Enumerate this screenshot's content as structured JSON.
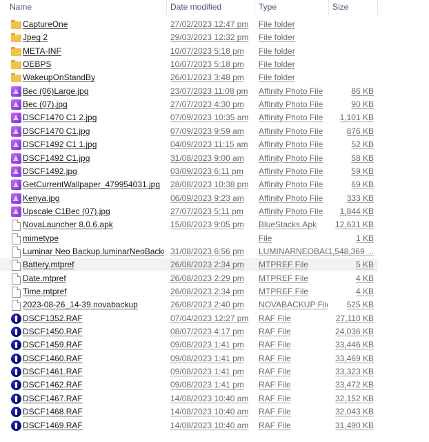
{
  "header": {
    "name": "Name",
    "date": "Date modified",
    "type": "Type",
    "size": "Size"
  },
  "rows": [
    {
      "icon": "folder-icon",
      "name": "CaptureOne",
      "date": "27/02/2023 12:47 pm",
      "type": "File folder",
      "size": ""
    },
    {
      "icon": "folder-icon",
      "name": "Jpeg 2",
      "date": "29/03/2023 12:32 pm",
      "type": "File folder",
      "size": ""
    },
    {
      "icon": "folder-icon",
      "name": "META-INF",
      "date": "10/07/2023 5:18 pm",
      "type": "File folder",
      "size": ""
    },
    {
      "icon": "folder-icon",
      "name": "OEBPS",
      "date": "10/07/2023 5:18 pm",
      "type": "File folder",
      "size": ""
    },
    {
      "icon": "folder-icon",
      "name": "WakeupOnStandBy",
      "date": "26/01/2023 3:48 pm",
      "type": "File folder",
      "size": ""
    },
    {
      "icon": "affinity-photo-icon",
      "name": "Bec (06)Large.jpg",
      "date": "23/07/2023 11:08 pm",
      "type": "Affinity Photo File",
      "size": "86 KB"
    },
    {
      "icon": "affinity-photo-icon",
      "name": "Bec (07).jpg",
      "date": "27/07/2023 4:30 pm",
      "type": "Affinity Photo File",
      "size": "90 KB"
    },
    {
      "icon": "affinity-photo-icon",
      "name": "DSCF1470 C1 2.jpg",
      "date": "07/09/2023 10:35 am",
      "type": "Affinity Photo File",
      "size": "1,101 KB"
    },
    {
      "icon": "affinity-photo-icon",
      "name": "DSCF1470 C1.jpg",
      "date": "07/09/2023 9:59 am",
      "type": "Affinity Photo File",
      "size": "876 KB"
    },
    {
      "icon": "affinity-photo-icon",
      "name": "DSCF1492 C1 1.jpg",
      "date": "04/09/2023 11:15 am",
      "type": "Affinity Photo File",
      "size": "52 KB"
    },
    {
      "icon": "affinity-photo-icon",
      "name": "DSCF1492 C1.jpg",
      "date": "31/08/2023 9:00 am",
      "type": "Affinity Photo File",
      "size": "58 KB"
    },
    {
      "icon": "affinity-photo-icon",
      "name": "DSCF1492.jpg",
      "date": "03/09/2023 6:11 pm",
      "type": "Affinity Photo File",
      "size": "59 KB"
    },
    {
      "icon": "affinity-photo-icon",
      "name": "GetCurrentWallpaper_479954031.jpg",
      "date": "28/08/2023 10:38 pm",
      "type": "Affinity Photo File",
      "size": "69 KB"
    },
    {
      "icon": "affinity-photo-icon",
      "name": "Kenya.jpg",
      "date": "06/09/2023 9:23 am",
      "type": "Affinity Photo File",
      "size": "333 KB"
    },
    {
      "icon": "affinity-photo-icon",
      "name": "Upscale C1Bec (07).jpg",
      "date": "27/07/2023 5:11 pm",
      "type": "Affinity Photo File",
      "size": "1,844 KB"
    },
    {
      "icon": "file-icon",
      "name": "NovaLauncher 8.0.6.apk",
      "date": "15/08/2023 9:05 pm",
      "type": "BlueStacks.Apk",
      "size": "12,631 KB"
    },
    {
      "icon": "file-icon",
      "name": "mimetype",
      "date": "",
      "type": "File",
      "size": "1 KB"
    },
    {
      "icon": "file-icon",
      "name": "Luminar Neo Backup.luminarNeoBackup",
      "date": "31/08/2023 6:56 pm",
      "type": "LUMINARNEOBAC...",
      "size": "1,548,369 ..."
    },
    {
      "icon": "file-icon",
      "name": "Battery.mtpref",
      "date": "26/08/2023 2:34 pm",
      "type": "MTPREF File",
      "size": "5 KB"
    },
    {
      "icon": "file-icon",
      "name": "Date.mtpref",
      "date": "26/08/2023 2:29 pm",
      "type": "MTPREF File",
      "size": "4 KB"
    },
    {
      "icon": "file-icon",
      "name": "Time.mtpref",
      "date": "26/08/2023 2:34 pm",
      "type": "MTPREF File",
      "size": "4 KB"
    },
    {
      "icon": "file-icon",
      "name": "2023-08-26_14-39.novabackup",
      "date": "26/08/2023 2:40 pm",
      "type": "NOVABACKUP File",
      "size": "525 KB"
    },
    {
      "icon": "raf-icon",
      "name": "DSCF1352.RAF",
      "date": "07/04/2023 12:27 pm",
      "type": "RAF File",
      "size": "27,110 KB"
    },
    {
      "icon": "raf-icon",
      "name": "DSCF1450.RAF",
      "date": "08/07/2023 4:17 pm",
      "type": "RAF File",
      "size": "24,036 KB"
    },
    {
      "icon": "raf-icon",
      "name": "DSCF1459.RAF",
      "date": "09/08/2023 1:41 pm",
      "type": "RAF File",
      "size": "33,446 KB"
    },
    {
      "icon": "raf-icon",
      "name": "DSCF1460.RAF",
      "date": "09/08/2023 1:41 pm",
      "type": "RAF File",
      "size": "33,469 KB"
    },
    {
      "icon": "raf-icon",
      "name": "DSCF1461.RAF",
      "date": "09/08/2023 1:41 pm",
      "type": "RAF File",
      "size": "33,323 KB"
    },
    {
      "icon": "raf-icon",
      "name": "DSCF1462.RAF",
      "date": "09/08/2023 1:41 pm",
      "type": "RAF File",
      "size": "33,472 KB"
    },
    {
      "icon": "raf-icon",
      "name": "DSCF1467.RAF",
      "date": "14/08/2023 10:40 am",
      "type": "RAF File",
      "size": "32,152 KB"
    },
    {
      "icon": "raf-icon",
      "name": "DSCF1468.RAF",
      "date": "14/08/2023 10:40 am",
      "type": "RAF File",
      "size": "32,043 KB"
    },
    {
      "icon": "raf-icon",
      "name": "DSCF1469.RAF",
      "date": "14/08/2023 10:40 am",
      "type": "RAF File",
      "size": "31,490 KB"
    }
  ]
}
